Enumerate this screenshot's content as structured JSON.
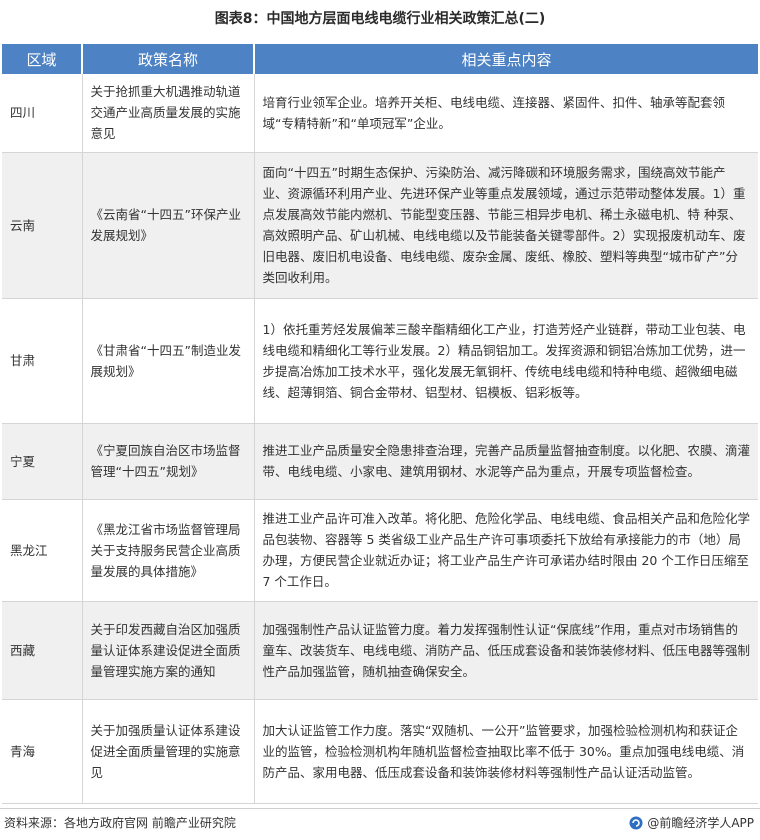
{
  "title": "图表8：中国地方层面电线电缆行业相关政策汇总(二)",
  "table": {
    "headers": [
      "区域",
      "政策名称",
      "相关重点内容"
    ],
    "rows": [
      {
        "region": "四川",
        "policy": "关于抢抓重大机遇推动轨道交通产业高质量发展的实施意见",
        "content": "培育行业领军企业。培养开关柜、电线电缆、连接器、紧固件、扣件、轴承等配套领域“专精特新”和“单项冠军”企业。"
      },
      {
        "region": "云南",
        "policy": "《云南省“十四五”环保产业发展规划》",
        "content": "面向“十四五”时期生态保护、污染防治、减污降碳和环境服务需求，围绕高效节能产业、资源循环利用产业、先进环保产业等重点发展领域，通过示范带动整体发展。1）重点发展高效节能内燃机、节能型变压器、节能三相异步电机、稀土永磁电机、特 种泵、高效照明产品、矿山机械、电线电缆以及节能装备关键零部件。2）实现报废机动车、废旧电器、废旧机电设备、电线电缆、废杂金属、废纸、橡胶、塑料等典型“城市矿产”分类回收利用。"
      },
      {
        "region": "甘肃",
        "policy": "《甘肃省“十四五”制造业发展规划》",
        "content": "1）依托重芳烃发展偏苯三酸辛酯精细化工产业，打造芳烃产业链群，带动工业包装、电线电缆和精细化工等行业发展。2）精品铜铝加工。发挥资源和铜铝冶炼加工优势，进一步提高冶炼加工技术水平，强化发展无氧铜杆、传统电线电缆和特种电缆、超微细电磁线、超薄铜箔、铜合金带材、铝型材、铝模板、铝彩板等。"
      },
      {
        "region": "宁夏",
        "policy": "《宁夏回族自治区市场监督管理“十四五”规划》",
        "content": "推进工业产品质量安全隐患排查治理，完善产品质量监督抽查制度。以化肥、农膜、滴灌带、电线电缆、小家电、建筑用钢材、水泥等产品为重点，开展专项监督检查。"
      },
      {
        "region": "黑龙江",
        "policy": "《黑龙江省市场监督管理局关于支持服务民营企业高质量发展的具体措施》",
        "content": "推进工业产品许可准入改革。将化肥、危险化学品、电线电缆、食品相关产品和危险化学品包装物、容器等 5 类省级工业产品生产许可事项委托下放给有承接能力的市（地）局办理，方便民营企业就近办证；将工业产品生产许可承诺办结时限由 20 个工作日压缩至 7 个工作日。"
      },
      {
        "region": "西藏",
        "policy": "关于印发西藏自治区加强质量认证体系建设促进全面质量管理实施方案的通知",
        "content": "加强强制性产品认证监管力度。着力发挥强制性认证“保底线”作用，重点对市场销售的童车、改装货车、电线电缆、消防产品、低压成套设备和装饰装修材料、低压电器等强制性产品加强监管，随机抽查确保安全。"
      },
      {
        "region": "青海",
        "policy": "关于加强质量认证体系建设促进全面质量管理的实施意见",
        "content": "加大认证监管工作力度。落实“双随机、一公开”监管要求，加强检验检测机构和获证企业的监管，检验检测机构年随机监督检查抽取比率不低于 30%。重点加强电线电缆、消防产品、家用电器、低压成套设备和装饰装修材料等强制性产品认证活动监管。"
      }
    ]
  },
  "footer": {
    "source": "资料来源：各地方政府官网 前瞻产业研究院",
    "brand": "@前瞻经济学人APP"
  },
  "colors": {
    "header_bg": "#4d82c4",
    "row_alt_bg": "#f0f0f0"
  }
}
